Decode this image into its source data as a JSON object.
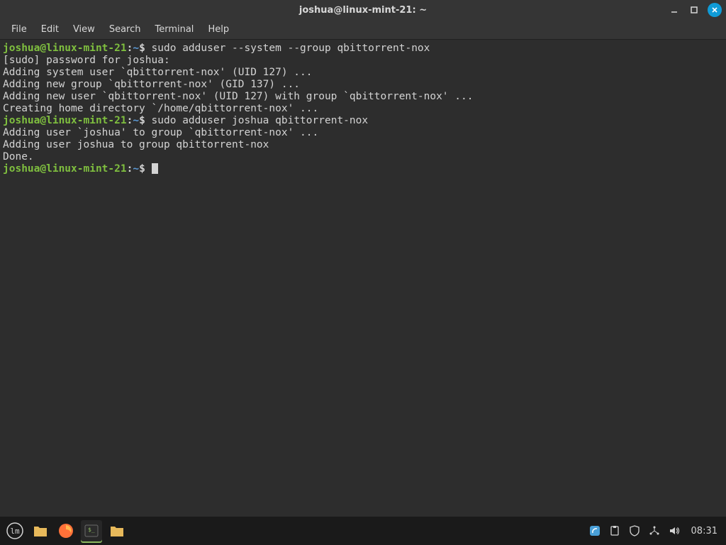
{
  "window": {
    "title": "joshua@linux-mint-21: ~"
  },
  "menubar": {
    "items": [
      "File",
      "Edit",
      "View",
      "Search",
      "Terminal",
      "Help"
    ]
  },
  "terminal": {
    "lines": [
      {
        "type": "prompt",
        "user": "joshua@linux-mint-21",
        "colon": ":",
        "path": "~",
        "dollar": "$ ",
        "cmd": "sudo adduser --system --group qbittorrent-nox"
      },
      {
        "type": "out",
        "text": "[sudo] password for joshua: "
      },
      {
        "type": "out",
        "text": "Adding system user `qbittorrent-nox' (UID 127) ..."
      },
      {
        "type": "out",
        "text": "Adding new group `qbittorrent-nox' (GID 137) ..."
      },
      {
        "type": "out",
        "text": "Adding new user `qbittorrent-nox' (UID 127) with group `qbittorrent-nox' ..."
      },
      {
        "type": "out",
        "text": "Creating home directory `/home/qbittorrent-nox' ..."
      },
      {
        "type": "prompt",
        "user": "joshua@linux-mint-21",
        "colon": ":",
        "path": "~",
        "dollar": "$ ",
        "cmd": "sudo adduser joshua qbittorrent-nox"
      },
      {
        "type": "out",
        "text": "Adding user `joshua' to group `qbittorrent-nox' ..."
      },
      {
        "type": "out",
        "text": "Adding user joshua to group qbittorrent-nox"
      },
      {
        "type": "out",
        "text": "Done."
      },
      {
        "type": "prompt",
        "user": "joshua@linux-mint-21",
        "colon": ":",
        "path": "~",
        "dollar": "$ ",
        "cmd": "",
        "cursor": true
      }
    ]
  },
  "taskbar": {
    "clock": "08:31"
  }
}
